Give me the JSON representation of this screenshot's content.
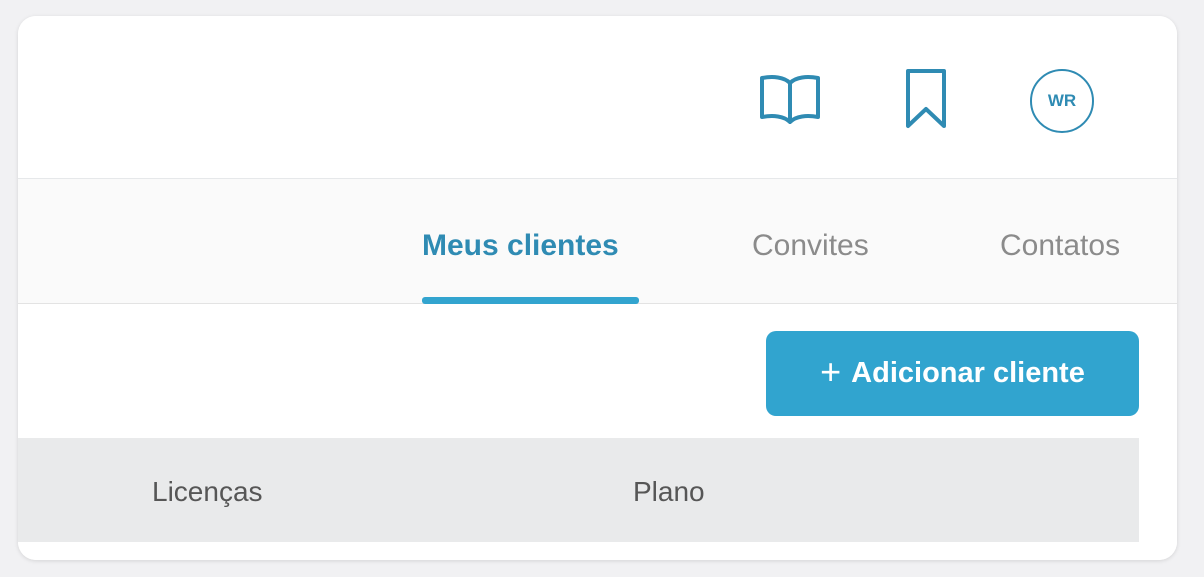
{
  "header": {
    "icons": {
      "book": "book-open-icon",
      "bookmark": "bookmark-icon"
    },
    "avatar_initials": "WR"
  },
  "tabs": [
    {
      "label": "Meus clientes",
      "active": true
    },
    {
      "label": "Convites",
      "active": false
    },
    {
      "label": "Contatos",
      "active": false
    }
  ],
  "actions": {
    "add_client_label": "Adicionar cliente",
    "add_icon": "plus-icon"
  },
  "table": {
    "columns": [
      "Licenças",
      "Plano"
    ]
  },
  "colors": {
    "accent": "#31a4cf",
    "accent_dark": "#2f8bb3",
    "tab_inactive": "#8b8b8b",
    "table_header_bg": "#e9eaeb",
    "page_bg": "#f1f1f3"
  }
}
